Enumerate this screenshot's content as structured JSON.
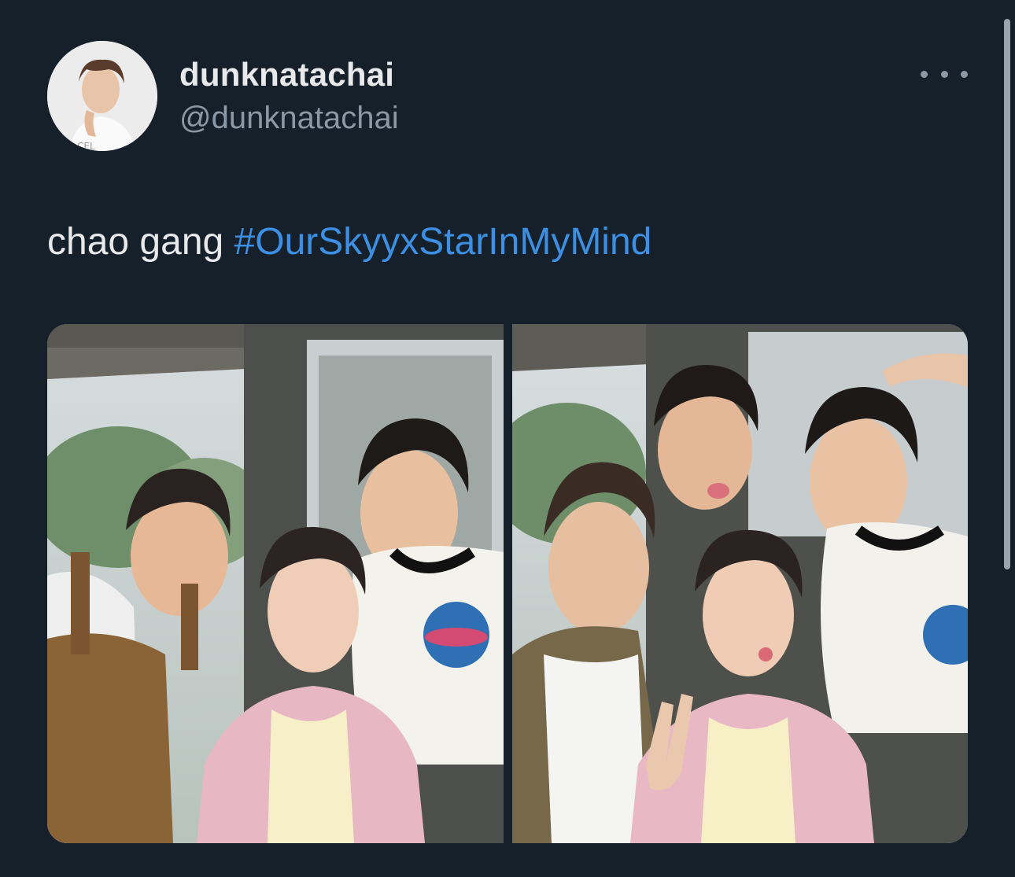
{
  "tweet": {
    "display_name": "dunknatachai",
    "handle": "@dunknatachai",
    "text": "chao gang",
    "hashtag": "#OurSkyyxStarInMyMind",
    "photos": [
      {
        "name": "photo-1",
        "description_icon": "group-selfie-image"
      },
      {
        "name": "photo-2",
        "description_icon": "group-selfie-image"
      }
    ]
  },
  "colors": {
    "background": "#15202b",
    "text_primary": "#e7e9ea",
    "text_secondary": "#8b98a5",
    "hashtag": "#3c8fe2"
  }
}
